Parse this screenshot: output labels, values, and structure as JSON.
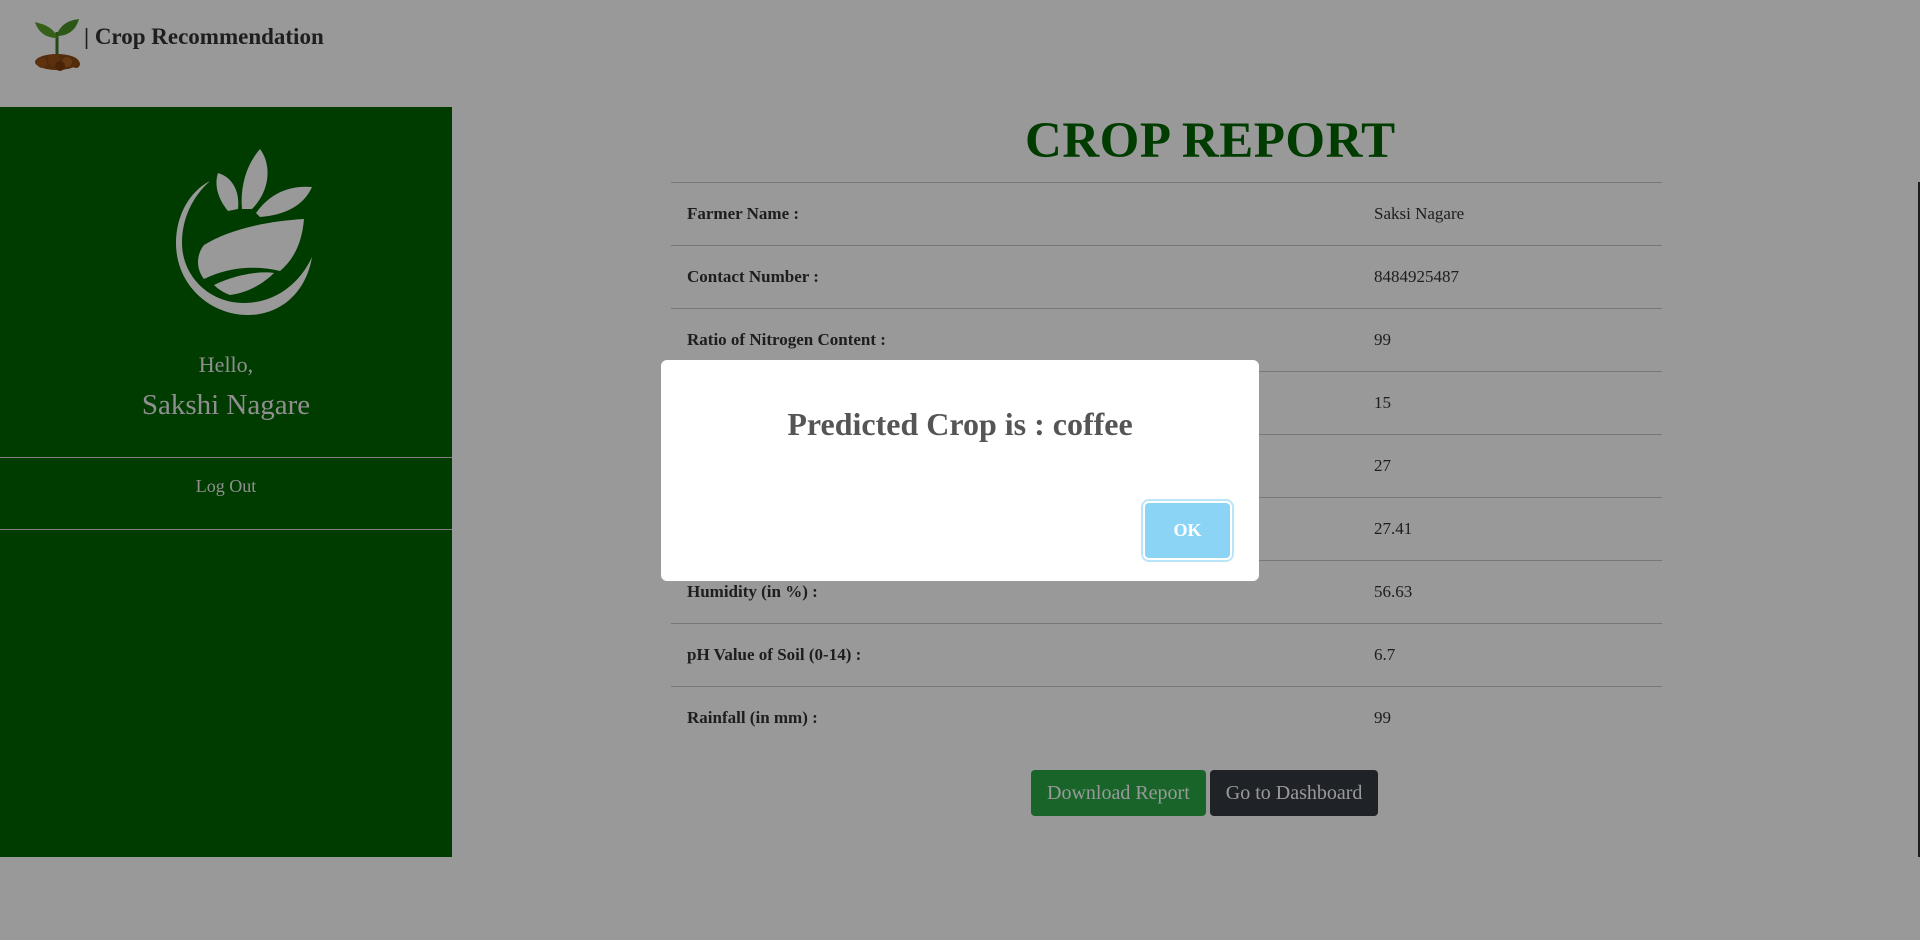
{
  "header": {
    "app_title": "| Crop Recommendation"
  },
  "sidebar": {
    "greeting": "Hello,",
    "user_name": "Sakshi Nagare",
    "logout_label": "Log Out"
  },
  "report": {
    "title": "CROP REPORT",
    "rows": [
      {
        "label": "Farmer Name :",
        "value": "Saksi Nagare"
      },
      {
        "label": "Contact Number :",
        "value": "8484925487"
      },
      {
        "label": "Ratio of Nitrogen Content :",
        "value": "99"
      },
      {
        "label": "",
        "value": "15"
      },
      {
        "label": "",
        "value": "27"
      },
      {
        "label": "",
        "value": "27.41"
      },
      {
        "label": "Humidity (in %) :",
        "value": "56.63"
      },
      {
        "label": "pH Value of Soil (0-14) :",
        "value": "6.7"
      },
      {
        "label": "Rainfall (in mm) :",
        "value": "99"
      }
    ],
    "download_label": "Download Report",
    "dashboard_label": "Go to Dashboard"
  },
  "modal": {
    "message": "Predicted Crop is : coffee",
    "ok_label": "OK"
  },
  "colors": {
    "sidebar_bg": "#006400",
    "title_green": "#006400",
    "download_btn": "#28a745",
    "dashboard_btn": "#343a40",
    "ok_btn": "#8cd4f5"
  },
  "icons": {
    "brand": "sprout-in-soil-icon",
    "sidebar_logo": "leaf-field-logo-icon"
  }
}
